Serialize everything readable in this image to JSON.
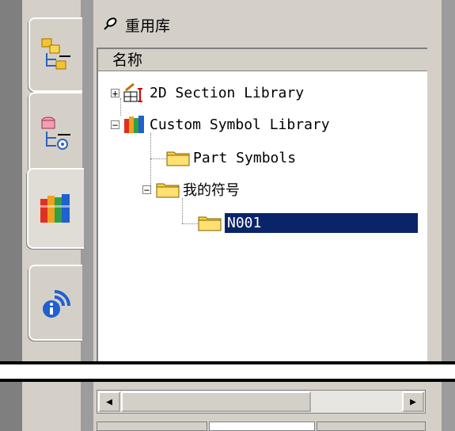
{
  "panel": {
    "title": "重用库",
    "column_header": "名称"
  },
  "tree": {
    "items": [
      {
        "label": "2D Section Library",
        "expander": "+",
        "icon": "section-library-icon"
      },
      {
        "label": "Custom Symbol Library",
        "expander": "−",
        "icon": "books-library-icon"
      },
      {
        "label": "Part Symbols",
        "icon": "folder-icon"
      },
      {
        "label": "我的符号",
        "expander": "−",
        "icon": "folder-icon"
      },
      {
        "label": "N001",
        "icon": "folder-icon",
        "selected": true
      }
    ]
  },
  "side_tabs": [
    {
      "icon": "assembly-navigator-icon"
    },
    {
      "icon": "part-navigator-icon"
    },
    {
      "icon": "reuse-library-icon",
      "active": true
    },
    {
      "icon": "info-icon"
    }
  ],
  "scrollbar": {
    "left_arrow": "◀",
    "right_arrow": "▶"
  },
  "colors": {
    "selection": "#0a246a",
    "panel_bg": "#d4d0c8"
  }
}
